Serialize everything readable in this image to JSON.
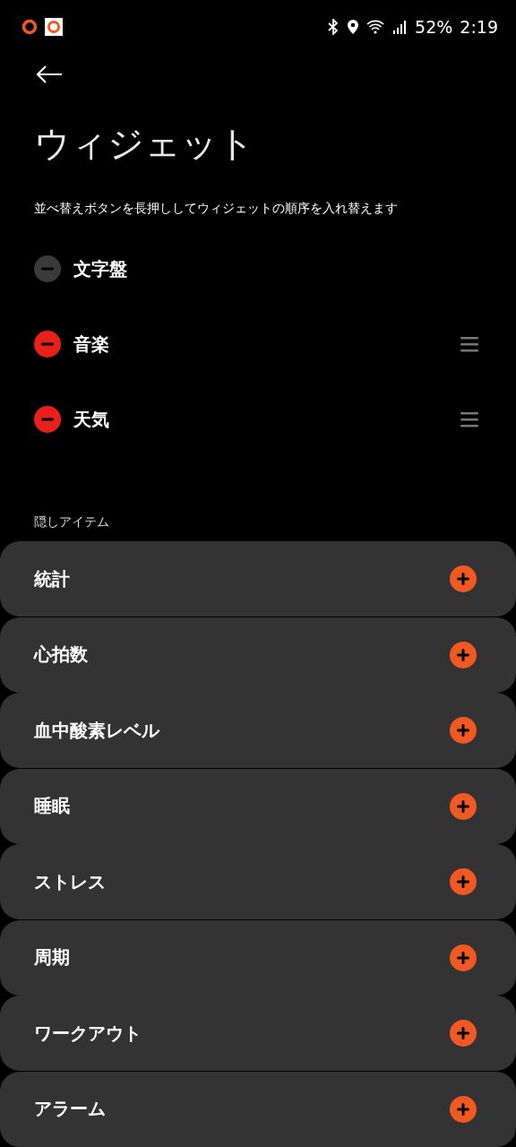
{
  "status_bar": {
    "battery": "52%",
    "time": "2:19"
  },
  "title": "ウィジェット",
  "hint": "並べ替えボタンを長押ししてウィジェットの順序を入れ替えます",
  "active_widgets": [
    {
      "label": "文字盤",
      "disabled": true
    },
    {
      "label": "音楽",
      "disabled": false
    },
    {
      "label": "天気",
      "disabled": false
    }
  ],
  "hidden_section": {
    "label": "隠しアイテム",
    "items": [
      {
        "label": "統計"
      },
      {
        "label": "心拍数"
      },
      {
        "label": "血中酸素レベル"
      },
      {
        "label": "睡眠"
      },
      {
        "label": "ストレス"
      },
      {
        "label": "周期"
      },
      {
        "label": "ワークアウト"
      },
      {
        "label": "アラーム"
      }
    ]
  }
}
